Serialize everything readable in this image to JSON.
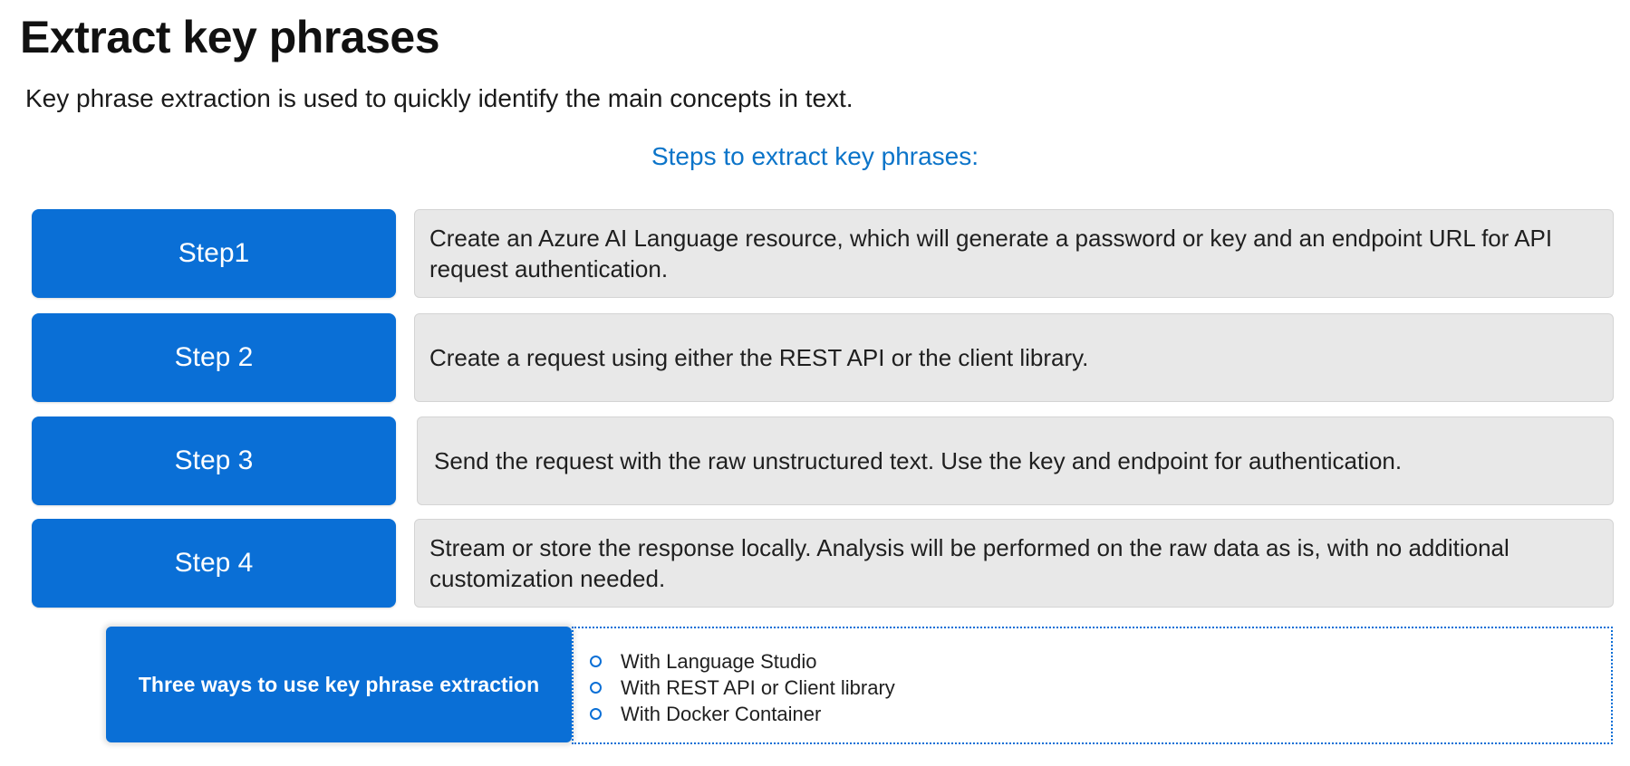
{
  "header": {
    "title": "Extract key phrases",
    "subtitle": "Key phrase extraction is used to quickly identify the main concepts in text.",
    "steps_heading": "Steps to extract key phrases:"
  },
  "steps": [
    {
      "label": "Step1",
      "description": "Create an Azure AI Language resource, which will generate a password or key and an endpoint URL for API request authentication."
    },
    {
      "label": "Step 2",
      "description": "Create a request using either the REST API or the client library."
    },
    {
      "label": "Step 3",
      "description": "Send the request with the raw unstructured text. Use the key and endpoint for authentication."
    },
    {
      "label": "Step 4",
      "description": "Stream or store the response locally. Analysis will be performed on the raw data as is, with no additional customization needed."
    }
  ],
  "ways": {
    "label": "Three ways to use key phrase extraction",
    "items": [
      "With Language Studio",
      "With REST API or Client library",
      "With Docker Container"
    ]
  },
  "colors": {
    "accent": "#0a6fd6",
    "heading_blue": "#0b74c9",
    "panel_gray": "#e8e8e8"
  }
}
